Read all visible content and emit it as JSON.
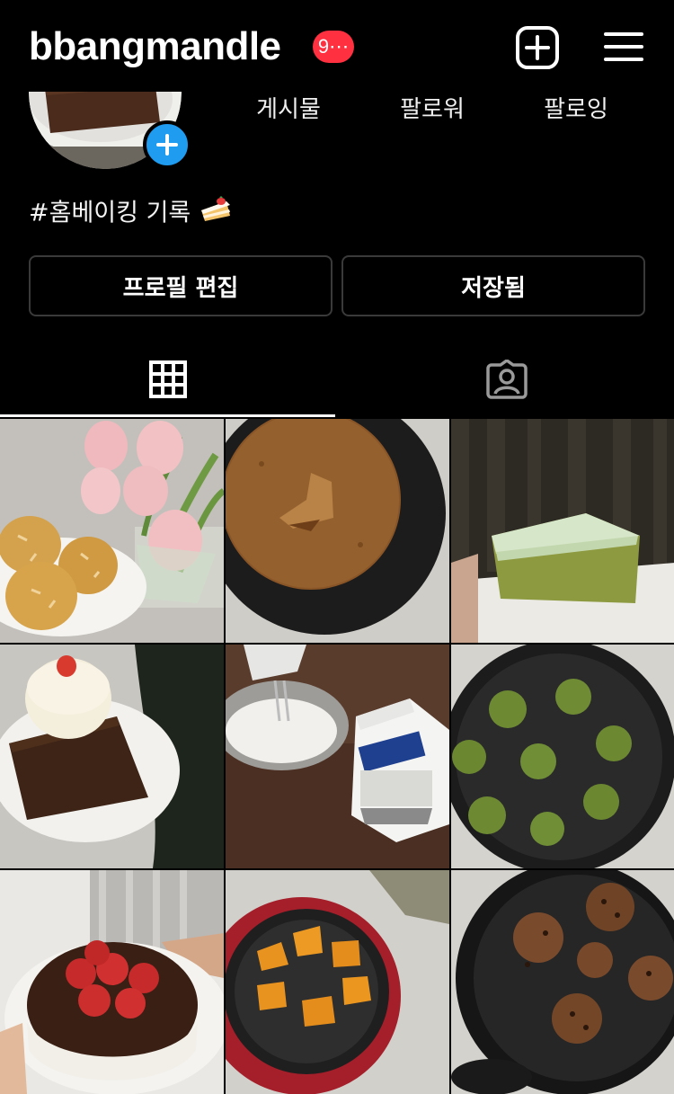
{
  "header": {
    "username": "bbangmandle",
    "notification_badge": "9⋯",
    "add_icon": "plus-square-icon",
    "menu_icon": "hamburger-menu-icon"
  },
  "profile": {
    "stats": {
      "posts_label": "게시물",
      "followers_label": "팔로워",
      "following_label": "팔로잉"
    },
    "bio": "#홈베이킹 기록",
    "bio_emoji": "shortcake-icon",
    "add_story_icon": "plus-icon"
  },
  "actions": {
    "edit_profile_label": "프로필 편집",
    "saved_label": "저장됨"
  },
  "tabs": [
    {
      "icon": "grid-icon",
      "selected": true
    },
    {
      "icon": "tagged-person-icon",
      "selected": false
    }
  ],
  "posts": [
    {
      "alt": "cookies with tulips"
    },
    {
      "alt": "sponge cake in pan"
    },
    {
      "alt": "matcha cake slice"
    },
    {
      "alt": "brownie with ice cream"
    },
    {
      "alt": "whipping cream mixing"
    },
    {
      "alt": "matcha dough balls"
    },
    {
      "alt": "chocolate strawberry cake"
    },
    {
      "alt": "scones on tray"
    },
    {
      "alt": "chocolate chip cookies"
    }
  ],
  "colors": {
    "background": "#000000",
    "badge": "#ff3040",
    "add_story": "#1f9bf0",
    "button_border": "#3a3a3a"
  }
}
